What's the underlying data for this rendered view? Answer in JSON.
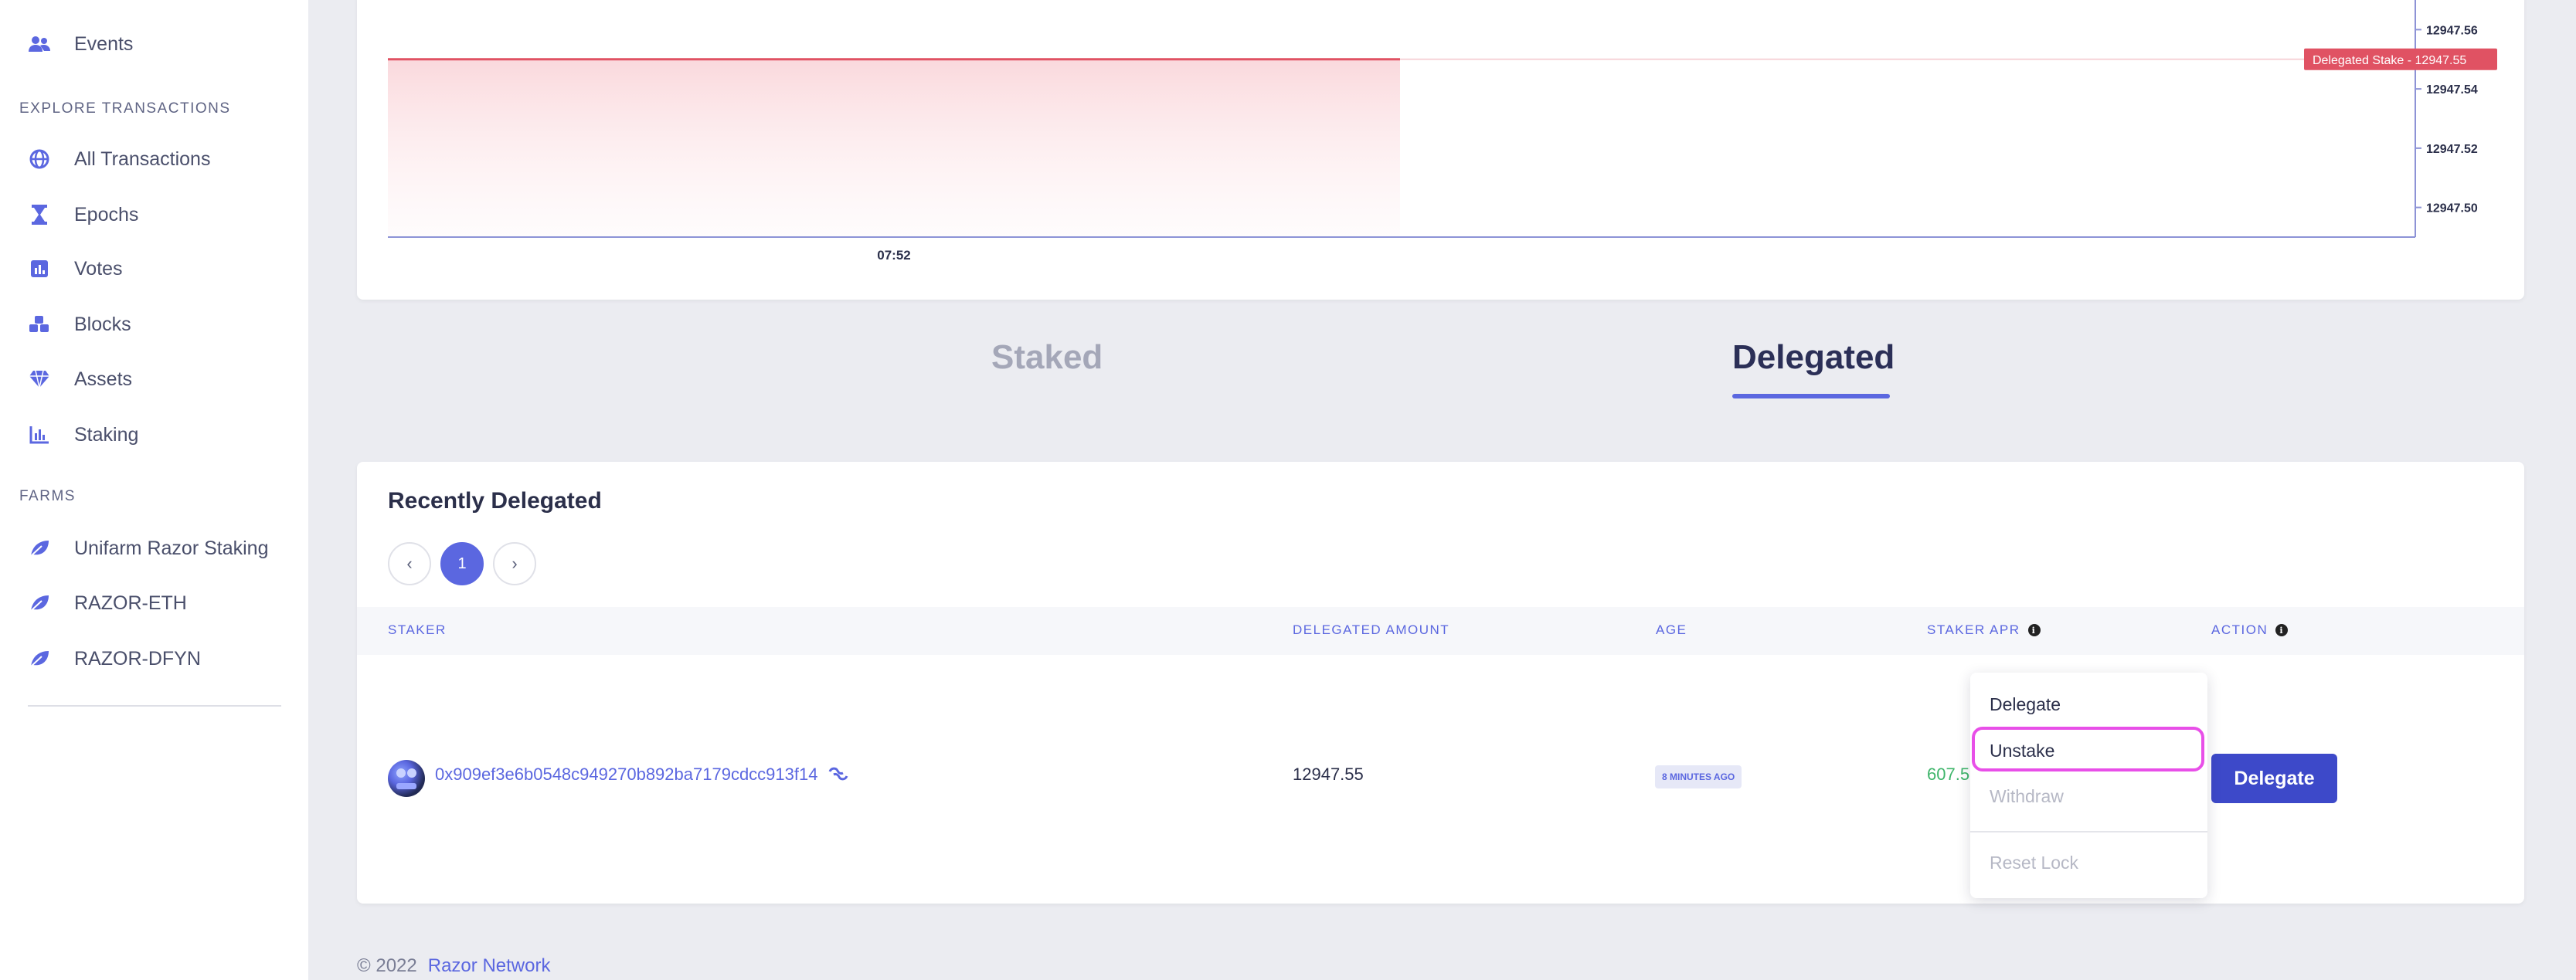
{
  "sidebar": {
    "items_top": [
      {
        "label": "Events",
        "icon": "users-icon"
      }
    ],
    "section_explore": "EXPLORE TRANSACTIONS",
    "explore_items": [
      {
        "label": "All Transactions",
        "icon": "globe-icon"
      },
      {
        "label": "Epochs",
        "icon": "hourglass-icon"
      },
      {
        "label": "Votes",
        "icon": "ballot-icon"
      },
      {
        "label": "Blocks",
        "icon": "blocks-icon"
      },
      {
        "label": "Assets",
        "icon": "diamond-icon"
      },
      {
        "label": "Staking",
        "icon": "bar-chart-icon"
      }
    ],
    "section_farms": "FARMS",
    "farm_items": [
      {
        "label": "Unifarm Razor Staking",
        "icon": "leaf-icon"
      },
      {
        "label": "RAZOR-ETH",
        "icon": "leaf-icon"
      },
      {
        "label": "RAZOR-DFYN",
        "icon": "leaf-icon"
      }
    ]
  },
  "chart_data": {
    "type": "area",
    "series": [
      {
        "name": "Delegated Stake",
        "x": [
          "07:52"
        ],
        "values": [
          12947.55
        ]
      }
    ],
    "x_tick_labels": [
      "07:52"
    ],
    "y_tick_labels": [
      "12947.56",
      "12947.54",
      "12947.52",
      "12947.50"
    ],
    "ylim": [
      12947.49,
      12947.57
    ],
    "current_label": "Delegated Stake",
    "current_value": "12947.55",
    "line_color": "#e05263"
  },
  "tabs": {
    "staked": "Staked",
    "delegated": "Delegated",
    "active": "Delegated"
  },
  "recent": {
    "title": "Recently Delegated",
    "pagination": {
      "prev": "‹",
      "current": "1",
      "next": "›"
    },
    "columns": {
      "staker": "STAKER",
      "amount": "DELEGATED AMOUNT",
      "age": "AGE",
      "apr": "STAKER APR",
      "action": "ACTION"
    },
    "rows": [
      {
        "staker": "0x909ef3e6b0548c949270b892ba7179cdcc913f14",
        "amount": "12947.55",
        "age": "8 MINUTES AGO",
        "apr": "607.5",
        "action": "Delegate"
      }
    ]
  },
  "dropdown": {
    "items": [
      "Delegate",
      "Unstake",
      "Withdraw",
      "Reset Lock"
    ],
    "highlighted": "Unstake"
  },
  "footer": {
    "copyright": "© 2022",
    "link": "Razor Network"
  },
  "colors": {
    "accent": "#5b67e0",
    "primary_button": "#3d49c9",
    "chart_line": "#e05263",
    "apr_green": "#3fb56b",
    "highlight": "#e84fe8"
  }
}
